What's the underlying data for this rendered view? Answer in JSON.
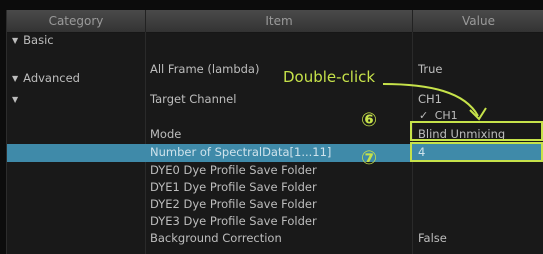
{
  "columns": [
    "Category",
    "Item",
    "Value"
  ],
  "rows": [
    {
      "category": "Basic",
      "category_arrow": true,
      "item": "",
      "value": ""
    },
    {
      "category": "",
      "item": "All Frame (lambda)",
      "value": "True"
    },
    {
      "category": "Advanced",
      "category_arrow": true,
      "item": "",
      "value": ""
    },
    {
      "category": "",
      "category_arrow": true,
      "item": "Target Channel",
      "value": "CH1"
    },
    {
      "category": "",
      "item": "",
      "value": ""
    },
    {
      "category": "",
      "item": "Mode",
      "value": "Blind Unmixing"
    },
    {
      "category": "",
      "item": "Number of SpectralData[1...11]",
      "value": "4",
      "selected": true
    },
    {
      "category": "",
      "item": "DYE0 Dye Profile Save Folder",
      "value": ""
    },
    {
      "category": "",
      "item": "DYE1 Dye Profile Save Folder",
      "value": ""
    },
    {
      "category": "",
      "item": "DYE2 Dye Profile Save Folder",
      "value": ""
    },
    {
      "category": "",
      "item": "DYE3 Dye Profile Save Folder",
      "value": ""
    },
    {
      "category": "",
      "item": "Background Correction",
      "value": "False"
    }
  ],
  "channel_dropdown": {
    "checkmark": "✓",
    "option": "CH1"
  },
  "annotations": {
    "double_click": "Double-click",
    "step6": "⑥",
    "step7": "⑦",
    "color": "#c6e24a"
  },
  "colors": {
    "selected_row": "#3f8aa9",
    "header_bg": "#3e3e3e",
    "grid_bg": "#191919"
  }
}
